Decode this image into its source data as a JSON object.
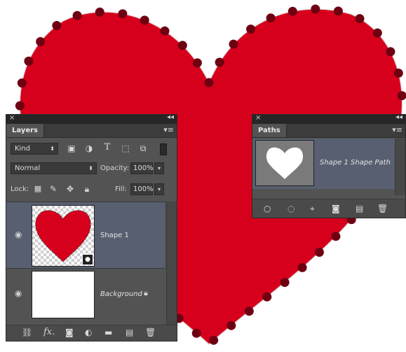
{
  "colors": {
    "heart": "#d7001c",
    "anchor": "#6e0012",
    "panel": "#535353",
    "selected_row": "#575f70"
  },
  "layers_panel": {
    "close": "×",
    "collapse": "◂◂",
    "tab": "Layers",
    "menu": "▾≡",
    "filter_kind": "Kind",
    "blend_mode": "Normal",
    "opacity_label": "Opacity:",
    "opacity_value": "100%",
    "lock_label": "Lock:",
    "fill_label": "Fill:",
    "fill_value": "100%",
    "layers": [
      {
        "name": "Shape 1",
        "selected": true,
        "visible": true
      },
      {
        "name": "Background",
        "selected": false,
        "visible": true,
        "locked": true
      }
    ],
    "footer_icons": [
      "link-icon",
      "fx-icon",
      "mask-icon",
      "adjustment-icon",
      "folder-icon",
      "new-layer-icon",
      "trash-icon"
    ],
    "fx_label": "fx."
  },
  "paths_panel": {
    "close": "×",
    "collapse": "◂◂",
    "tab": "Paths",
    "menu": "▾≡",
    "path_name": "Shape 1 Shape Path",
    "footer_icons": [
      "fill-path-icon",
      "stroke-path-icon",
      "load-selection-icon",
      "make-mask-icon",
      "new-path-icon",
      "trash-icon"
    ]
  }
}
